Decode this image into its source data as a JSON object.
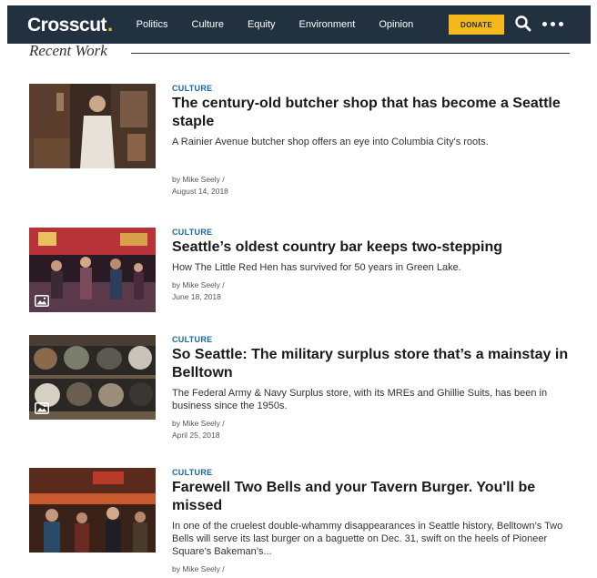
{
  "header": {
    "logo": "Crosscut",
    "logo_dot": ".",
    "nav": [
      "Politics",
      "Culture",
      "Equity",
      "Environment",
      "Opinion"
    ],
    "donate": "DONATE"
  },
  "section": {
    "title": "Recent Work"
  },
  "articles": [
    {
      "category": "CULTURE",
      "headline": "The century-old butcher shop that has become a Seattle staple",
      "dek": "A Rainier Avenue butcher shop offers an eye into Columbia City's roots.",
      "byline_prefix": "by ",
      "author": "Mike Seely",
      "byline_suffix": " /",
      "date": "August 14, 2018"
    },
    {
      "category": "CULTURE",
      "headline": "Seattle’s oldest country bar keeps two-stepping",
      "dek": "How The Little Red Hen has survived for 50 years in Green Lake.",
      "byline_prefix": "by ",
      "author": "Mike Seely",
      "byline_suffix": " /",
      "date": "June 18, 2018"
    },
    {
      "category": "CULTURE",
      "headline": "So Seattle: The military surplus store that’s a mainstay in Belltown",
      "dek": "The Federal Army & Navy Surplus store, with its MREs and Ghillie Suits, has been in business since the 1950s.",
      "byline_prefix": "by ",
      "author": "Mike Seely",
      "byline_suffix": " /",
      "date": "April 25, 2018"
    },
    {
      "category": "CULTURE",
      "headline": "Farewell Two Bells and your Tavern Burger. You'll be missed",
      "dek": "In one of the cruelest double-whammy disappearances in Seattle history, Belltown’s Two Bells will serve its last burger on a baguette on Dec. 31, swift on the heels of Pioneer Square’s Bakeman’s...",
      "byline_prefix": "by ",
      "author": "Mike Seely",
      "byline_suffix": " /"
    }
  ],
  "colors": {
    "nav_bg": "#21313f",
    "accent": "#f5b91e",
    "category": "#1565a8"
  },
  "icons": [
    "search-icon",
    "more-icon",
    "gallery-icon"
  ]
}
